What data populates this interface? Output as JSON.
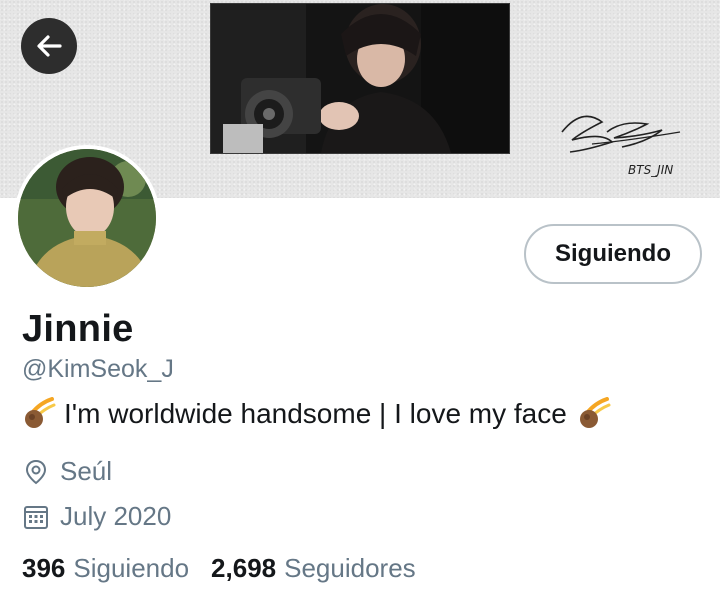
{
  "header": {
    "back_icon": "arrow-left-icon",
    "signature_text": "BTS_JIN"
  },
  "profile": {
    "name": "Jinnie",
    "handle": "@KimSeok_J",
    "bio": "I'm worldwide handsome | I love my face",
    "bio_emoji": "comet-icon",
    "location": "Seúl",
    "location_icon": "location-pin-icon",
    "joined": "July 2020",
    "joined_icon": "calendar-icon"
  },
  "actions": {
    "follow_label": "Siguiendo"
  },
  "stats": {
    "following_count": "396",
    "following_label": "Siguiendo",
    "followers_count": "2,698",
    "followers_label": "Seguidores"
  },
  "colors": {
    "text_primary": "#14171a",
    "text_secondary": "#657786",
    "button_border": "#b9c2c8",
    "back_button": "#2d2d2d"
  }
}
